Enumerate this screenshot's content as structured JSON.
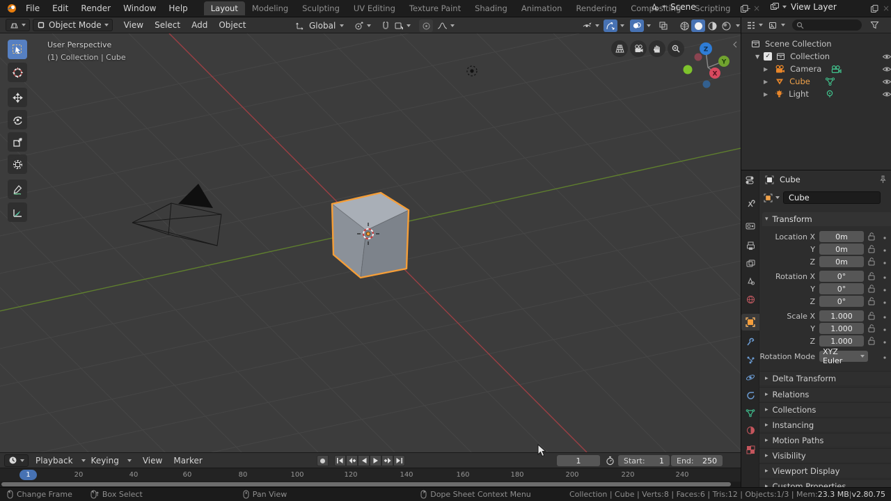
{
  "topbar": {
    "menus": [
      "File",
      "Edit",
      "Render",
      "Window",
      "Help"
    ],
    "workspaces": [
      "Layout",
      "Modeling",
      "Sculpting",
      "UV Editing",
      "Texture Paint",
      "Shading",
      "Animation",
      "Rendering",
      "Compositing",
      "Scripting"
    ],
    "add_workspace": "+",
    "scene_label": "Scene",
    "view_layer_label": "View Layer"
  },
  "viewport_header": {
    "mode": "Object Mode",
    "menus": [
      "View",
      "Select",
      "Add",
      "Object"
    ],
    "orientation": "Global"
  },
  "viewport": {
    "perspective_label": "User Perspective",
    "context_label": "(1) Collection | Cube",
    "gizmo": {
      "x": "X",
      "y": "Y",
      "z": "Z"
    },
    "tools": [
      "select-box",
      "cursor",
      "move",
      "rotate",
      "scale",
      "transform",
      "annotate",
      "measure"
    ]
  },
  "outliner": {
    "rows": [
      {
        "label": "Scene Collection"
      },
      {
        "label": "Collection"
      },
      {
        "label": "Camera"
      },
      {
        "label": "Cube"
      },
      {
        "label": "Light"
      }
    ]
  },
  "properties": {
    "breadcrumb": "Cube",
    "name_field": "Cube",
    "transform_title": "Transform",
    "rows": [
      {
        "label": "Location X",
        "value": "0m"
      },
      {
        "label": "Y",
        "value": "0m"
      },
      {
        "label": "Z",
        "value": "0m"
      },
      {
        "label": "Rotation X",
        "value": "0°"
      },
      {
        "label": "Y",
        "value": "0°"
      },
      {
        "label": "Z",
        "value": "0°"
      },
      {
        "label": "Scale X",
        "value": "1.000"
      },
      {
        "label": "Y",
        "value": "1.000"
      },
      {
        "label": "Z",
        "value": "1.000"
      }
    ],
    "rotation_mode_label": "Rotation Mode",
    "rotation_mode_value": "XYZ Euler",
    "panels": [
      "Delta Transform",
      "Relations",
      "Collections",
      "Instancing",
      "Motion Paths",
      "Visibility",
      "Viewport Display",
      "Custom Properties"
    ]
  },
  "timeline": {
    "menus": [
      "Playback",
      "Keying",
      "View",
      "Marker"
    ],
    "current_frame": "1",
    "start_label": "Start:",
    "start_value": "1",
    "end_label": "End:",
    "end_value": "250",
    "marker": "1",
    "ticks": [
      "20",
      "40",
      "60",
      "80",
      "100",
      "120",
      "140",
      "160",
      "180",
      "200",
      "220",
      "240"
    ]
  },
  "statusbar": {
    "hints": [
      "Change Frame",
      "Box Select",
      "Pan View",
      "Dope Sheet Context Menu"
    ],
    "stats_prefix": "Collection | Cube | Verts:8 | Faces:6 | Tris:12 | Objects:1/3 | Mem: ",
    "mem": "23.3 MB",
    "divider": " | ",
    "version": "v2.80.75"
  },
  "colors": {
    "accent": "#4772b3",
    "active_outline": "#f59e38",
    "axis_green": "#5f7f2e",
    "axis_red": "#9c3f44"
  }
}
